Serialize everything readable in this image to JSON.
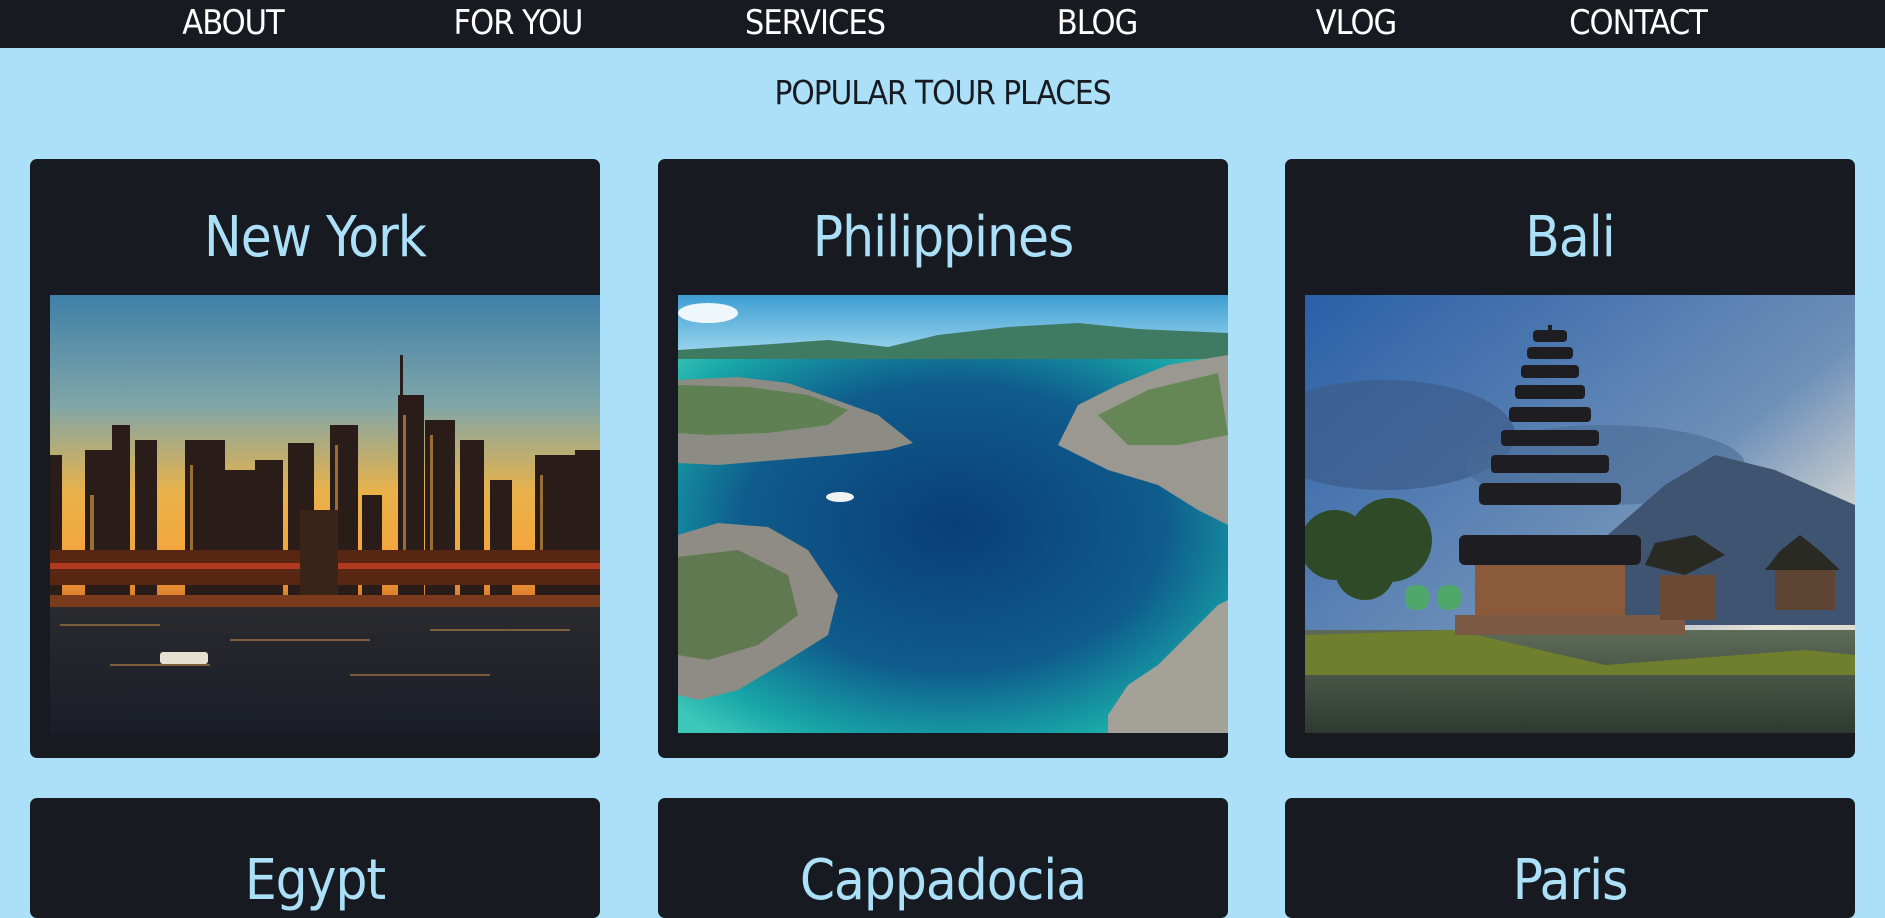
{
  "nav": {
    "items": [
      {
        "label": "ABOUT"
      },
      {
        "label": "FOR YOU"
      },
      {
        "label": "SERVICES"
      },
      {
        "label": "BLOG"
      },
      {
        "label": "VLOG"
      },
      {
        "label": "CONTACT"
      }
    ]
  },
  "section": {
    "title": "POPULAR TOUR PLACES"
  },
  "places": [
    {
      "title": "New York",
      "image": "New York skyline at sunset over the river"
    },
    {
      "title": "Philippines",
      "image": "Turquoise lagoon with limestone islands"
    },
    {
      "title": "Bali",
      "image": "Lakeside pagoda temple under cloudy sky"
    },
    {
      "title": "Egypt"
    },
    {
      "title": "Cappadocia"
    },
    {
      "title": "Paris"
    }
  ],
  "colors": {
    "background": "#ABE0F8",
    "dark": "#171A20",
    "accent": "#ABE0F8",
    "nav_text": "#FFFFFF"
  }
}
